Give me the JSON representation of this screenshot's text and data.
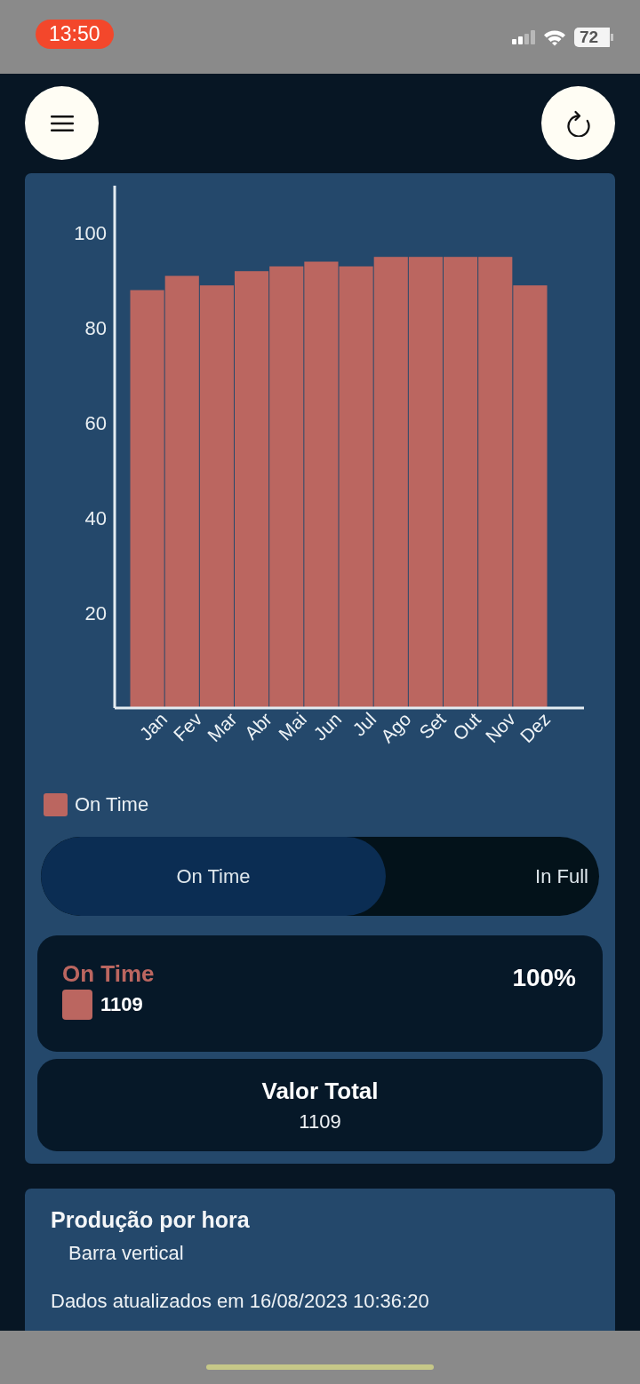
{
  "status_bar": {
    "time": "13:50",
    "battery": "72"
  },
  "chart_card": {
    "chart_data": {
      "type": "bar",
      "categories": [
        "Jan",
        "Fev",
        "Mar",
        "Abr",
        "Mai",
        "Jun",
        "Jul",
        "Ago",
        "Set",
        "Out",
        "Nov",
        "Dez"
      ],
      "series": [
        {
          "name": "On Time",
          "color": "#bb6660",
          "values": [
            88,
            91,
            89,
            92,
            93,
            94,
            93,
            95,
            95,
            95,
            95,
            89
          ]
        }
      ],
      "ylim": [
        0,
        110
      ],
      "yticks": [
        20,
        40,
        60,
        80,
        100
      ]
    },
    "segments": [
      {
        "label": "On Time",
        "selected": true
      },
      {
        "label": "In Full",
        "selected": false
      }
    ],
    "summary": [
      {
        "label": "On Time",
        "color": "#bb6660",
        "value": "1109",
        "percent": "100%"
      }
    ],
    "total": {
      "label": "Valor Total",
      "value": "1109"
    }
  },
  "info_card": {
    "title": "Produção por hora",
    "subtitle": "Barra vertical",
    "updated": "Dados atualizados em 16/08/2023 10:36:20"
  }
}
